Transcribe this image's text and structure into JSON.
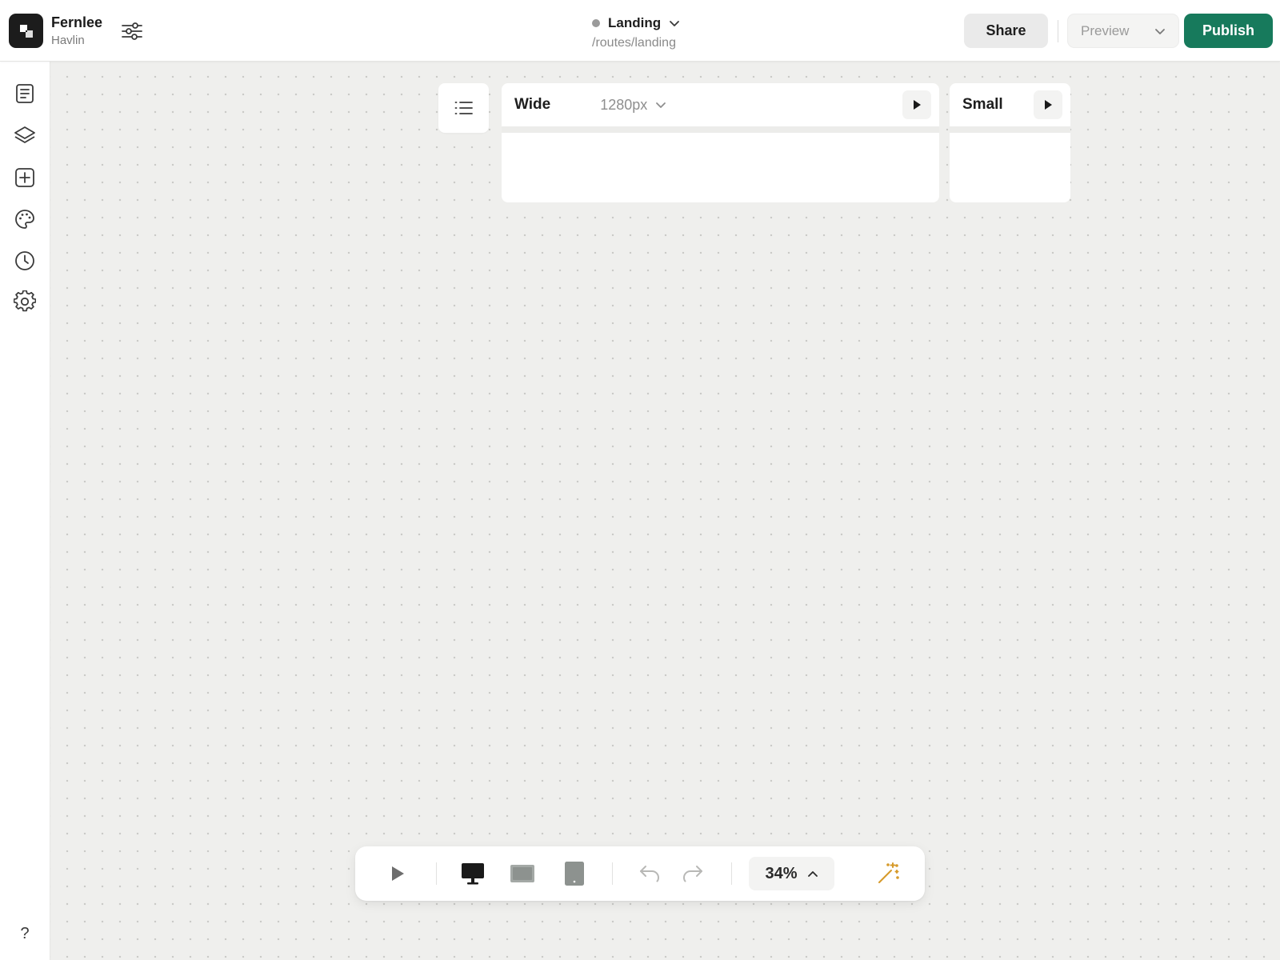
{
  "app": {
    "title": "Fernlee",
    "subtitle": "Havlin",
    "logo_icon": "app-logo-icon",
    "settings_icon": "sliders-icon"
  },
  "page": {
    "name": "Landing",
    "path": "/routes/landing",
    "status_color": "#9a9a9a"
  },
  "header_actions": {
    "share_label": "Share",
    "preview_label": "Preview",
    "publish_label": "Publish",
    "publish_color": "#177a5c"
  },
  "left_rail": {
    "items": [
      {
        "name": "pages",
        "icon": "document-icon"
      },
      {
        "name": "layers",
        "icon": "layers-icon"
      },
      {
        "name": "insert",
        "icon": "plus-square-icon"
      },
      {
        "name": "theme",
        "icon": "palette-icon"
      },
      {
        "name": "history",
        "icon": "clock-icon"
      },
      {
        "name": "settings",
        "icon": "gear-icon"
      }
    ],
    "help_label": "?"
  },
  "canvas": {
    "outline_icon": "list-icon",
    "frames": [
      {
        "name": "Wide",
        "size_label": "1280px"
      },
      {
        "name": "Small"
      }
    ]
  },
  "toolbar": {
    "zoom": "34%",
    "tools": [
      "play-icon",
      "desktop-icon",
      "tablet-landscape-icon",
      "phone-icon",
      "undo-icon",
      "redo-icon",
      "magic-wand-icon"
    ],
    "wand_color": "#d69a2a"
  }
}
